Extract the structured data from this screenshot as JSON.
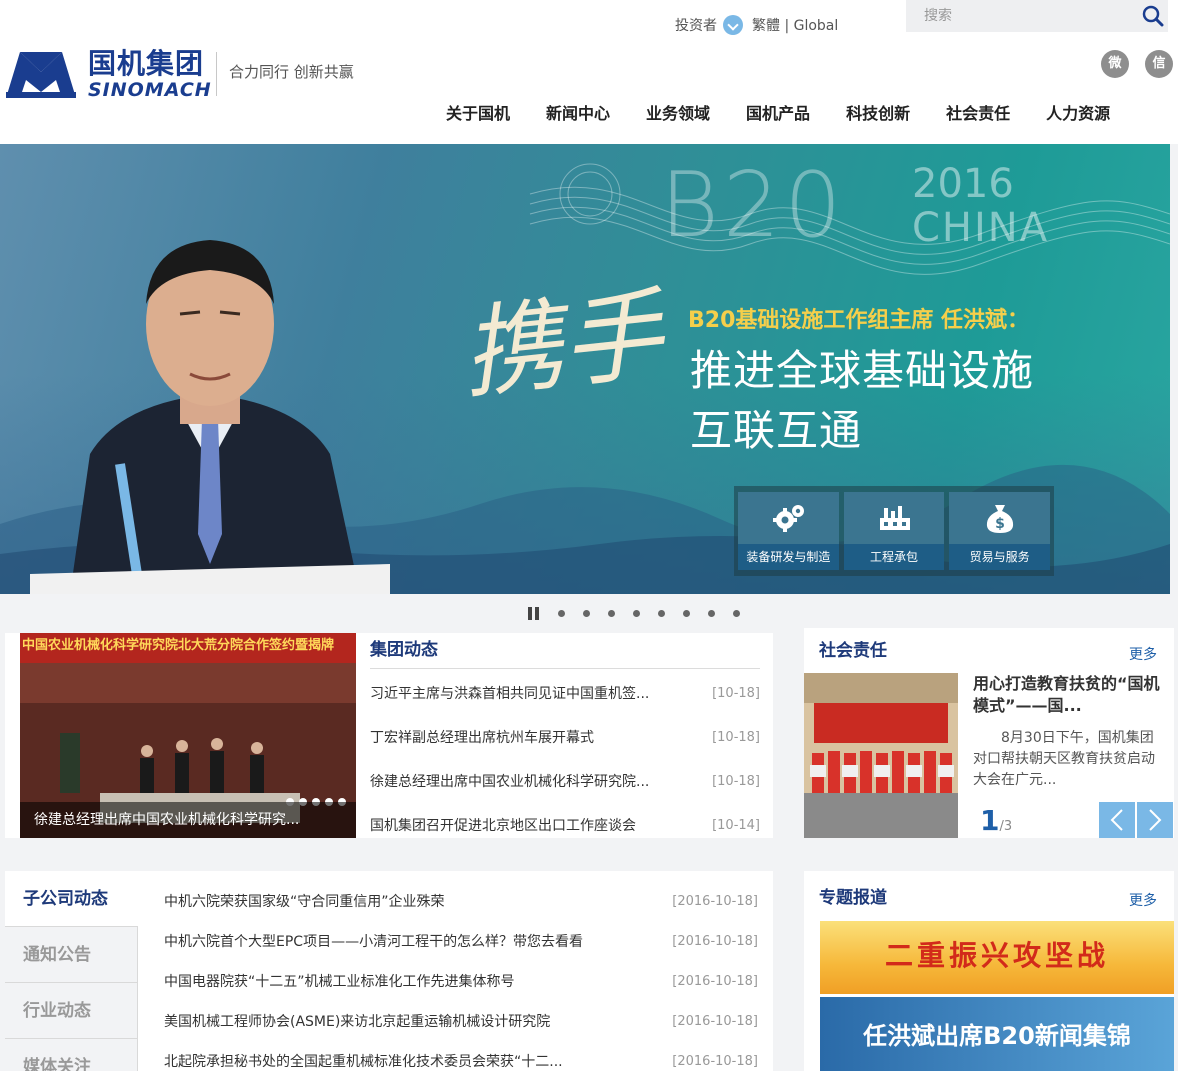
{
  "header": {
    "logo_cn": "国机集团",
    "logo_en": "SINOMACH",
    "slogan": "合力同行 创新共赢",
    "investor": "投资者",
    "lang": "繁體 | Global",
    "search_placeholder": "搜索",
    "social": [
      {
        "icon": "weibo-icon",
        "glyph": "微"
      },
      {
        "icon": "wechat-icon",
        "glyph": "信"
      }
    ]
  },
  "nav": [
    "关于国机",
    "新闻中心",
    "业务领域",
    "国机产品",
    "科技创新",
    "社会责任",
    "人力资源"
  ],
  "banner": {
    "logo_text": "B20",
    "logo_year": "2016",
    "logo_country": "CHINA",
    "calligraphy": "携手",
    "subtitle": "B20基础设施工作组主席 任洪斌：",
    "title_line1": "推进全球基础设施",
    "title_line2": "互联互通",
    "tiles": [
      {
        "label": "装备研发与制造",
        "icon": "gears-icon"
      },
      {
        "label": "工程承包",
        "icon": "factory-icon"
      },
      {
        "label": "贸易与服务",
        "icon": "money-bag-icon"
      }
    ],
    "slide_count": 8
  },
  "group_news": {
    "title": "集团动态",
    "photo_banner": "中国农业机械化科学研究院北大荒分院合作签约暨揭牌",
    "photo_caption": "徐建总经理出席中国农业机械化科学研究...",
    "items": [
      {
        "title": "习近平主席与洪森首相共同见证中国重机签...",
        "date": "[10-18]"
      },
      {
        "title": "丁宏祥副总经理出席杭州车展开幕式",
        "date": "[10-18]"
      },
      {
        "title": "徐建总经理出席中国农业机械化科学研究院...",
        "date": "[10-18]"
      },
      {
        "title": "国机集团召开促进北京地区出口工作座谈会",
        "date": "[10-14]"
      }
    ]
  },
  "csr": {
    "title": "社会责任",
    "more": "更多",
    "item_title": "用心打造教育扶贫的“国机模式”——国...",
    "item_desc": "8月30日下午，国机集团对口帮扶朝天区教育扶贫启动大会在广元...",
    "page_current": "1",
    "page_total": "/3"
  },
  "subsidiary": {
    "tabs": [
      "子公司动态",
      "通知公告",
      "行业动态",
      "媒体关注"
    ],
    "items": [
      {
        "title": "中机六院荣获国家级“守合同重信用”企业殊荣",
        "date": "[2016-10-18]"
      },
      {
        "title": "中机六院首个大型EPC项目——小清河工程干的怎么样？带您去看看",
        "date": "[2016-10-18]"
      },
      {
        "title": "中国电器院获“十二五”机械工业标准化工作先进集体称号",
        "date": "[2016-10-18]"
      },
      {
        "title": "美国机械工程师协会(ASME)来访北京起重运输机械设计研究院",
        "date": "[2016-10-18]"
      },
      {
        "title": "北起院承担秘书处的全国起重机械标准化技术委员会荣获“十二...",
        "date": "[2016-10-18]"
      }
    ]
  },
  "special": {
    "title": "专题报道",
    "more": "更多",
    "banner1": "二重振兴攻坚战",
    "banner2": "任洪斌出席B20新闻集锦"
  }
}
